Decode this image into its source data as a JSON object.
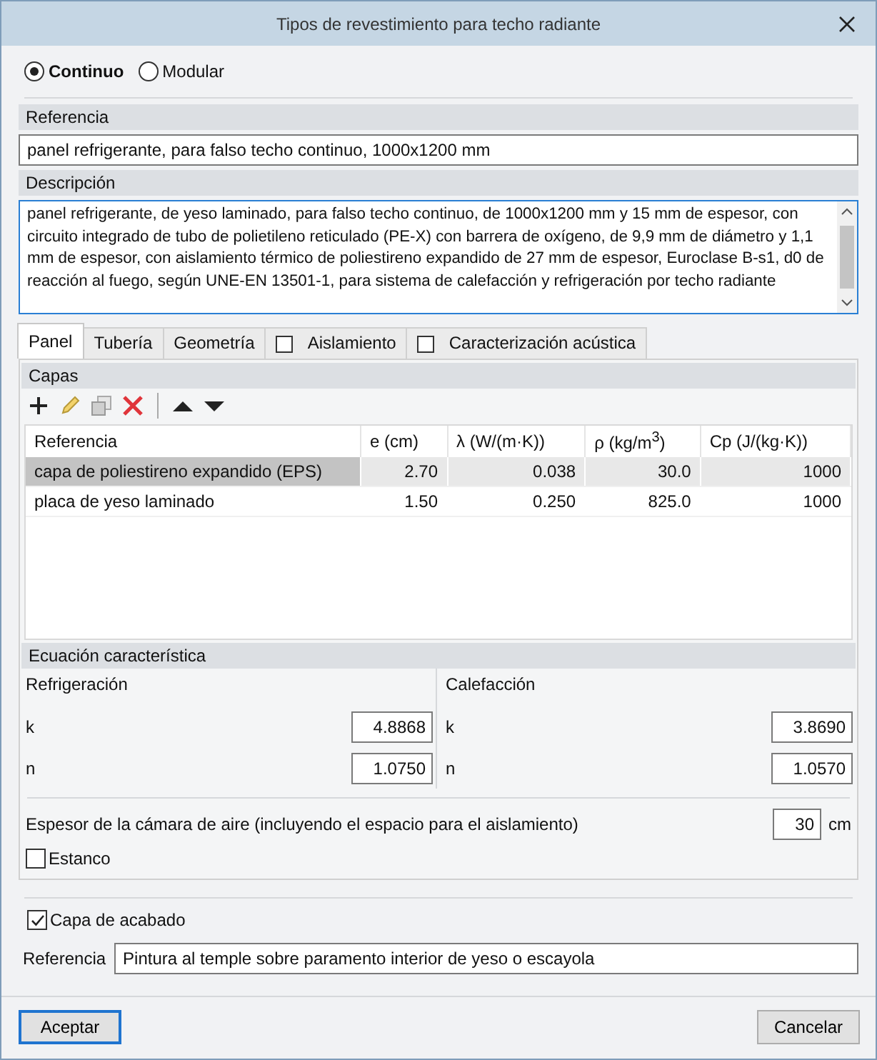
{
  "window": {
    "title": "Tipos de revestimiento para techo radiante"
  },
  "mode_options": [
    {
      "label": "Continuo",
      "selected": true
    },
    {
      "label": "Modular",
      "selected": false
    }
  ],
  "reference": {
    "label": "Referencia",
    "value": "panel refrigerante, para falso techo continuo, 1000x1200 mm"
  },
  "description": {
    "label": "Descripción",
    "value": "panel refrigerante, de yeso laminado, para falso techo continuo, de 1000x1200 mm y 15 mm de espesor, con circuito integrado de tubo de polietileno reticulado (PE-X) con barrera de oxígeno, de 9,9 mm de diámetro y 1,1 mm de espesor, con aislamiento térmico de poliestireno expandido de 27 mm de espesor, Euroclase B-s1, d0 de reacción al fuego, según UNE-EN 13501-1, para sistema de calefacción y refrigeración por techo radiante"
  },
  "tabs": [
    {
      "label": "Panel",
      "selected": true,
      "kind": "plain"
    },
    {
      "label": "Tubería",
      "selected": false,
      "kind": "plain"
    },
    {
      "label": "Geometría",
      "selected": false,
      "kind": "plain"
    },
    {
      "label": "Aislamiento",
      "selected": false,
      "kind": "checkbox",
      "checked": false
    },
    {
      "label": "Caracterización acústica",
      "selected": false,
      "kind": "checkbox",
      "checked": false
    }
  ],
  "layers": {
    "title": "Capas",
    "columns": [
      "Referencia",
      "e (cm)",
      "λ (W/(m·K))",
      "ρ (kg/m$^{3}$)",
      "Cp (J/(kg·K))"
    ],
    "rows": [
      {
        "selected": true,
        "cells": [
          "capa de poliestireno expandido (EPS)",
          "2.70",
          "0.038",
          "30.0",
          "1000"
        ]
      },
      {
        "selected": false,
        "cells": [
          "placa de yeso laminado",
          "1.50",
          "0.250",
          "825.0",
          "1000"
        ]
      }
    ]
  },
  "equation": {
    "title": "Ecuación característica",
    "groups": [
      {
        "title": "Refrigeración",
        "fields": [
          {
            "label": "k",
            "value": "4.8868"
          },
          {
            "label": "n",
            "value": "1.0750"
          }
        ]
      },
      {
        "title": "Calefacción",
        "fields": [
          {
            "label": "k",
            "value": "3.8690"
          },
          {
            "label": "n",
            "value": "1.0570"
          }
        ]
      }
    ]
  },
  "air_gap": {
    "label": "Espesor de la cámara de aire (incluyendo el espacio para el aislamiento)",
    "value": "30",
    "unit": "cm"
  },
  "sealed": {
    "label": "Estanco",
    "checked": false
  },
  "finish": {
    "label": "Capa de acabado",
    "checked": true
  },
  "finish_reference": {
    "label": "Referencia",
    "value": "Pintura al temple sobre paramento interior de yeso o escayola"
  },
  "buttons": [
    {
      "label": "Aceptar",
      "kind": "default"
    },
    {
      "label": "Cancelar",
      "kind": "normal"
    }
  ]
}
